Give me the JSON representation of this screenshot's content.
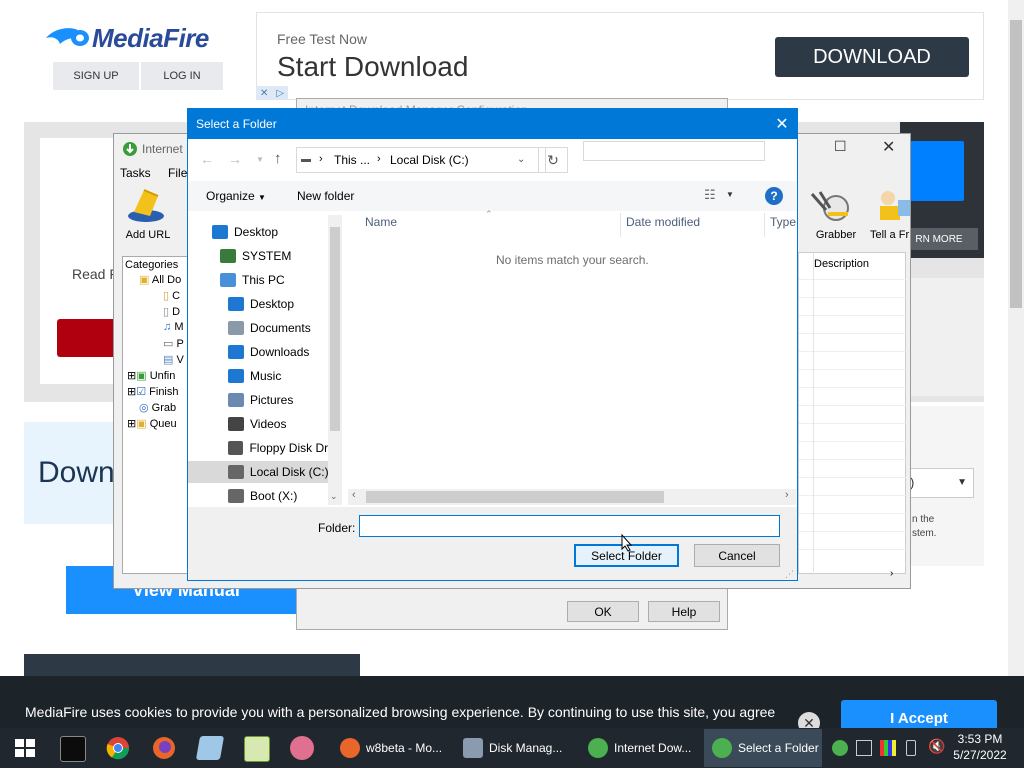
{
  "webpage": {
    "logo_text": "MediaFire",
    "sign_up": "SIGN UP",
    "log_in": "LOG IN",
    "ad_small": "Free Test Now",
    "ad_big": "Start Download",
    "ad_button": "DOWNLOAD",
    "read_text": "Read F",
    "learn_more": "RN MORE",
    "down_text": "Down",
    "view_manual": "View Manual",
    "right_select": ")",
    "right_small_1": "n the",
    "right_small_2": "stem.",
    "cookie_text": "MediaFire uses cookies to provide you with a personalized browsing experience. By continuing to use this site, you agree",
    "accept": "I Accept"
  },
  "idm_config": {
    "title": "Internet Download Manager Configuration",
    "ok": "OK",
    "help": "Help"
  },
  "idm": {
    "title": "Internet",
    "menu": [
      "Tasks",
      "File"
    ],
    "add_url": "Add URL",
    "grabber": "Grabber",
    "tell_a_friend": "Tell a Fr",
    "categories": "Categories",
    "tree": [
      "All Do",
      "C",
      "D",
      "M",
      "P",
      "V",
      "Unfin",
      "Finish",
      "Grab",
      "Queu"
    ],
    "description": "Description"
  },
  "dialog": {
    "title": "Select a Folder",
    "address_parts": [
      "This ...",
      "Local Disk (C:)"
    ],
    "organize": "Organize",
    "new_folder": "New folder",
    "tree": [
      {
        "label": "Desktop",
        "icon": "desktop-icon",
        "indent": 0
      },
      {
        "label": "SYSTEM",
        "icon": "user-icon",
        "indent": 1
      },
      {
        "label": "This PC",
        "icon": "pc-icon",
        "indent": 1
      },
      {
        "label": "Desktop",
        "icon": "desktop-icon",
        "indent": 2
      },
      {
        "label": "Documents",
        "icon": "documents-icon",
        "indent": 2
      },
      {
        "label": "Downloads",
        "icon": "downloads-icon",
        "indent": 2
      },
      {
        "label": "Music",
        "icon": "music-icon",
        "indent": 2
      },
      {
        "label": "Pictures",
        "icon": "pictures-icon",
        "indent": 2
      },
      {
        "label": "Videos",
        "icon": "videos-icon",
        "indent": 2
      },
      {
        "label": "Floppy Disk Dri",
        "icon": "floppy-icon",
        "indent": 2
      },
      {
        "label": "Local Disk (C:)",
        "icon": "drive-icon",
        "indent": 2,
        "selected": true
      },
      {
        "label": "Boot (X:)",
        "icon": "drive-icon",
        "indent": 2
      }
    ],
    "columns": [
      "Name",
      "Date modified",
      "Type"
    ],
    "empty_message": "No items match your search.",
    "folder_label": "Folder:",
    "folder_value": "",
    "select_folder": "Select Folder",
    "cancel": "Cancel"
  },
  "taskbar": {
    "tasks": [
      {
        "label": "w8beta - Mo...",
        "color": "#e8662a"
      },
      {
        "label": "Disk Manag...",
        "color": "#8a9bb0"
      },
      {
        "label": "Internet Dow...",
        "color": "#4caf50"
      },
      {
        "label": "Select a Folder",
        "color": "#4caf50",
        "active": true
      }
    ],
    "time": "3:53 PM",
    "date": "5/27/2022"
  },
  "colors": {
    "accent": "#0078d7",
    "taskbar": "#20272e",
    "mediafire_blue": "#1a90ff"
  }
}
